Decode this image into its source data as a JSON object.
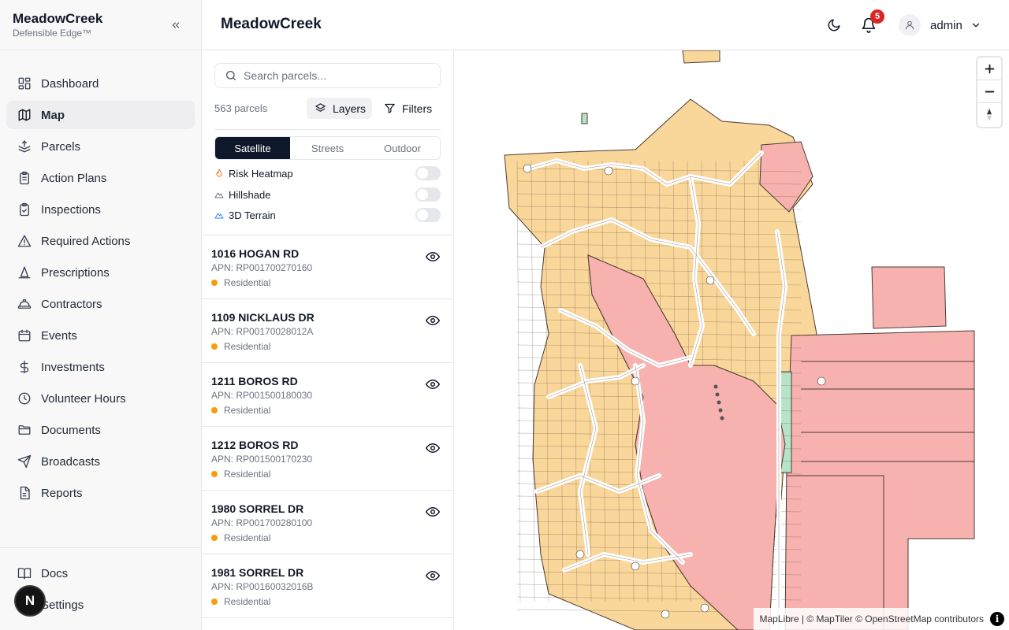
{
  "brand": {
    "name": "MeadowCreek",
    "tagline": "Defensible Edge™"
  },
  "nav": {
    "items": [
      {
        "label": "Dashboard",
        "icon": "dashboard-icon"
      },
      {
        "label": "Map",
        "icon": "map-icon",
        "active": true
      },
      {
        "label": "Parcels",
        "icon": "parcels-icon"
      },
      {
        "label": "Action Plans",
        "icon": "clipboard-icon"
      },
      {
        "label": "Inspections",
        "icon": "clipboard-check-icon"
      },
      {
        "label": "Required Actions",
        "icon": "warning-icon"
      },
      {
        "label": "Prescriptions",
        "icon": "cone-icon"
      },
      {
        "label": "Contractors",
        "icon": "hard-hat-icon"
      },
      {
        "label": "Events",
        "icon": "calendar-icon"
      },
      {
        "label": "Investments",
        "icon": "dollar-icon"
      },
      {
        "label": "Volunteer Hours",
        "icon": "clock-icon"
      },
      {
        "label": "Documents",
        "icon": "folder-icon"
      },
      {
        "label": "Broadcasts",
        "icon": "send-icon"
      },
      {
        "label": "Reports",
        "icon": "file-icon"
      }
    ],
    "bottom": [
      {
        "label": "Docs",
        "icon": "book-icon"
      },
      {
        "label": "Settings",
        "icon": "gear-icon"
      }
    ],
    "avatar_initial": "N"
  },
  "header": {
    "title": "MeadowCreek",
    "notification_count": "5",
    "user": "admin"
  },
  "panel": {
    "search_placeholder": "Search parcels...",
    "count": "563 parcels",
    "layers_label": "Layers",
    "filters_label": "Filters",
    "basemaps": [
      "Satellite",
      "Streets",
      "Outdoor"
    ],
    "active_basemap": "Satellite",
    "overlays": [
      {
        "label": "Risk Heatmap",
        "icon": "flame-icon",
        "on": false
      },
      {
        "label": "Hillshade",
        "icon": "mountain-icon",
        "on": false
      },
      {
        "label": "3D Terrain",
        "icon": "terrain-icon",
        "on": false
      }
    ],
    "parcels": [
      {
        "address": "1016 HOGAN RD",
        "apn": "APN: RP001700270160",
        "type": "Residential"
      },
      {
        "address": "1109 NICKLAUS DR",
        "apn": "APN: RP00170028012A",
        "type": "Residential"
      },
      {
        "address": "1211 BOROS RD",
        "apn": "APN: RP001500180030",
        "type": "Residential"
      },
      {
        "address": "1212 BOROS RD",
        "apn": "APN: RP001500170230",
        "type": "Residential"
      },
      {
        "address": "1980 SORREL DR",
        "apn": "APN: RP001700280100",
        "type": "Residential"
      },
      {
        "address": "1981 SORREL DR",
        "apn": "APN: RP00160032016B",
        "type": "Residential"
      }
    ]
  },
  "map": {
    "attribution": "MapLibre | © MapTiler © OpenStreetMap contributors",
    "colors": {
      "residential": "#f9d69a",
      "high_risk": "#f7b2b0",
      "green": "#b7e4c7",
      "outline": "#4b3b33"
    }
  }
}
